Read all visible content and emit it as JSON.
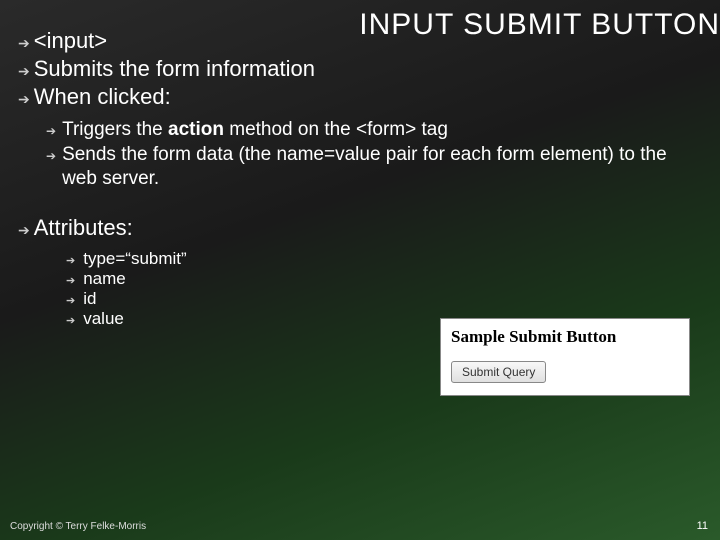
{
  "title": "INPUT SUBMIT BUTTON",
  "main_bullets": {
    "b1": "<input>",
    "b2": "Submits the form information",
    "b3": "When clicked:",
    "b3_subs": {
      "s1_pre": "Triggers the ",
      "s1_bold": "action",
      "s1_post": " method on the <form> tag",
      "s2": "Sends the form data (the name=value pair for each form element) to the web server."
    },
    "b4": "Attributes:",
    "b4_subs": {
      "a1": "type=“submit”",
      "a2": "name",
      "a3": "id",
      "a4": "value"
    }
  },
  "sample": {
    "heading": "Sample Submit Button",
    "button_label": "Submit Query"
  },
  "footer": {
    "copyright": "Copyright © Terry Felke-Morris",
    "page": "11"
  }
}
